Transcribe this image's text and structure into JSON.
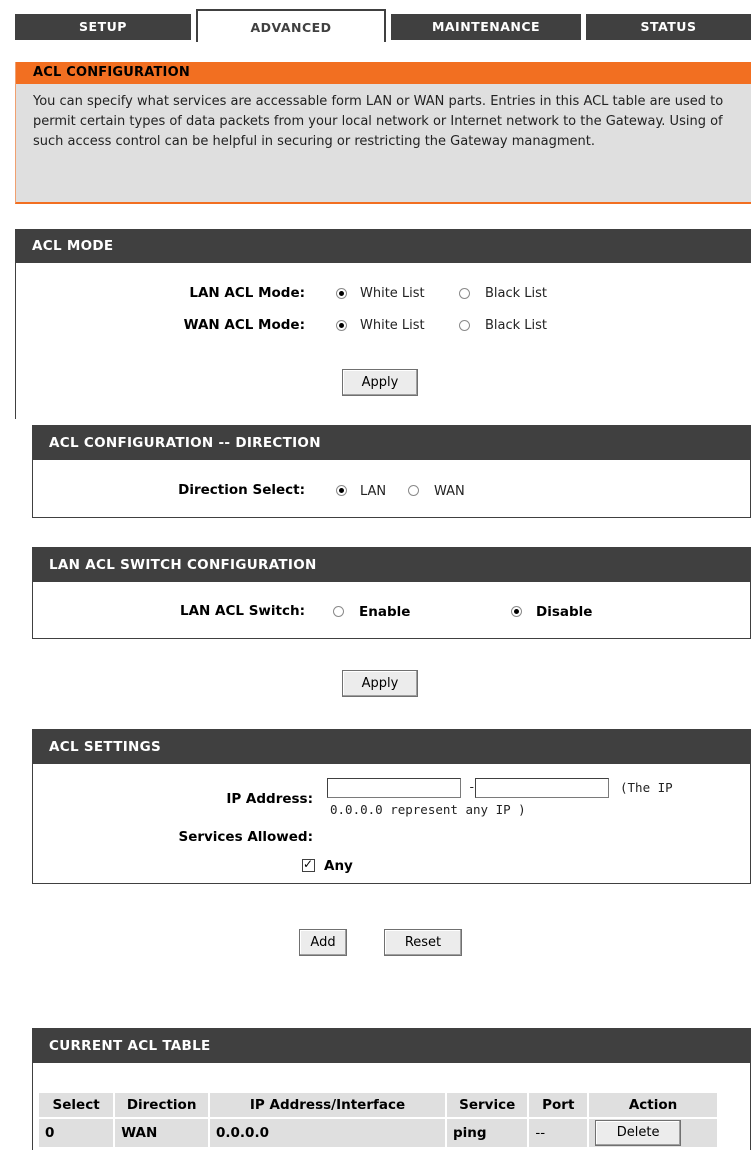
{
  "tabs": [
    {
      "label": "SETUP"
    },
    {
      "label": "ADVANCED"
    },
    {
      "label": "MAINTENANCE"
    },
    {
      "label": "STATUS"
    }
  ],
  "acl_configuration": {
    "title": "ACL CONFIGURATION",
    "description": "You can specify what services are accessable form LAN or WAN parts.  Entries in this ACL table are used to permit certain types of data packets from your local network or Internet network to the Gateway.  Using of such access control can be helpful in securing or restricting the Gateway managment."
  },
  "acl_mode": {
    "title": "ACL MODE",
    "lan_label": "LAN ACL Mode:",
    "wan_label": "WAN ACL Mode:",
    "white_list": "White List",
    "black_list": "Black List",
    "lan_selected": "White List",
    "wan_selected": "White List",
    "apply": "Apply"
  },
  "direction": {
    "title": "ACL CONFIGURATION -- DIRECTION",
    "label": "Direction Select:",
    "lan": "LAN",
    "wan": "WAN",
    "selected": "LAN"
  },
  "switch": {
    "title": "LAN ACL SWITCH CONFIGURATION",
    "label": "LAN ACL Switch:",
    "enable": "Enable",
    "disable": "Disable",
    "selected": "Disable",
    "apply": "Apply"
  },
  "settings": {
    "title": "ACL SETTINGS",
    "ip_label": "IP Address:",
    "ip_start": "",
    "ip_end": "",
    "separator": "-",
    "hint_1": "(The IP",
    "hint_2": "0.0.0.0 represent any IP )",
    "services_label": "Services Allowed:",
    "any_label": "Any",
    "any_checked": true,
    "add": "Add",
    "reset": "Reset"
  },
  "current_table": {
    "title": "CURRENT ACL TABLE",
    "headers": [
      "Select",
      "Direction",
      "IP Address/Interface",
      "Service",
      "Port",
      "Action"
    ],
    "rows": [
      {
        "select": "0",
        "direction": "WAN",
        "ip": "0.0.0.0",
        "service": "ping",
        "port": "--",
        "action": "Delete"
      }
    ]
  }
}
